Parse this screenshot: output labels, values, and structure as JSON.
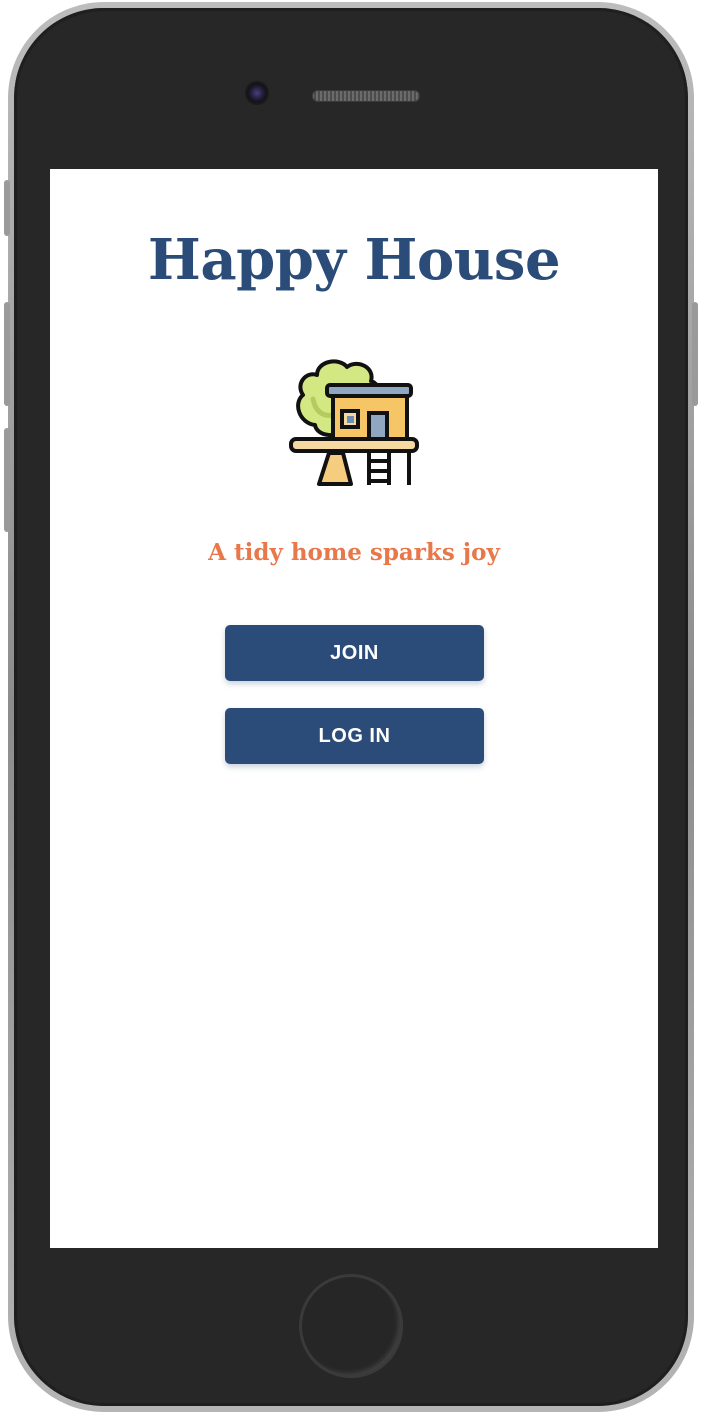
{
  "app": {
    "title": "Happy House",
    "tagline": "A tidy home sparks joy",
    "logo_icon": "treehouse-icon"
  },
  "actions": {
    "join_label": "JOIN",
    "login_label": "LOG IN"
  },
  "colors": {
    "primary": "#2b4c78",
    "accent": "#e8784a",
    "background": "#ffffff"
  }
}
